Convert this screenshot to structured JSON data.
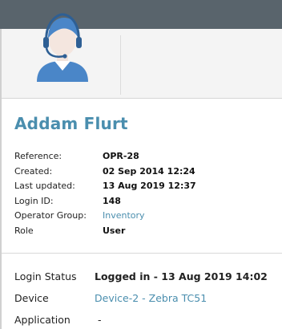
{
  "operator": {
    "name": "Addam Flurt",
    "avatar_icon": "operator-headset-icon"
  },
  "details": [
    {
      "label": "Reference:",
      "value": "OPR-28",
      "type": "bold"
    },
    {
      "label": "Created:",
      "value": "02 Sep 2014 12:24",
      "type": "bold"
    },
    {
      "label": "Last updated:",
      "value": "13 Aug 2019 12:37",
      "type": "bold"
    },
    {
      "label": "Login ID:",
      "value": "148",
      "type": "bold"
    },
    {
      "label": "Operator Group:",
      "value": "Inventory",
      "type": "link"
    },
    {
      "label": "Role",
      "value": "User",
      "type": "bold"
    }
  ],
  "status": [
    {
      "label": "Login Status",
      "value": "Logged in - 13 Aug 2019 14:02",
      "type": "bold"
    },
    {
      "label": "Device",
      "value": "Device-2 - Zebra TC51",
      "type": "link"
    },
    {
      "label": "Application",
      "value": "-",
      "type": "plain"
    }
  ],
  "colors": {
    "accent": "#4a8eae",
    "topbar": "#59646c",
    "avatar": "#4a86c8"
  }
}
